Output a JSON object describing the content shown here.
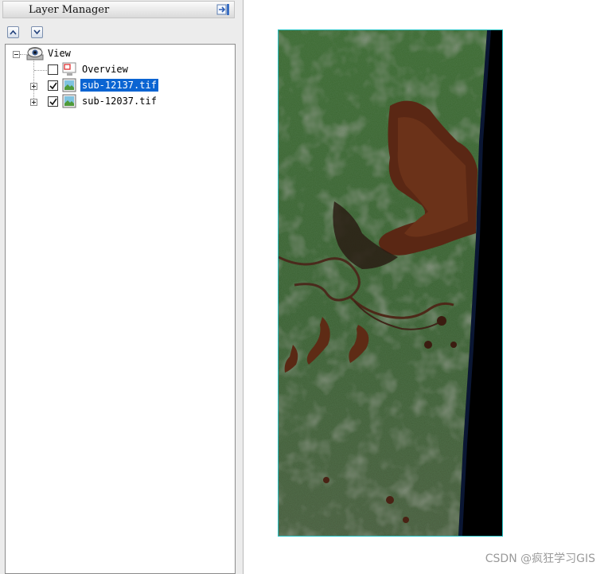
{
  "panel": {
    "title": "Layer Manager"
  },
  "toolbar": {
    "move_up_icon": "chevron-up-icon",
    "move_down_icon": "chevron-down-icon"
  },
  "tree": {
    "root": {
      "label": "View",
      "icon": "eye-icon",
      "expanded": true
    },
    "nodes": [
      {
        "label": "Overview",
        "icon": "overview-monitor-icon",
        "checked": false,
        "selected": false,
        "expandable": false
      },
      {
        "label": "sub-12137.tif",
        "icon": "raster-image-icon",
        "checked": true,
        "selected": true,
        "expandable": true
      },
      {
        "label": "sub-12037.tif",
        "icon": "raster-image-icon",
        "checked": true,
        "selected": false,
        "expandable": true
      }
    ]
  },
  "colors": {
    "selection": "#0a64d2",
    "map_border": "#27c3c6",
    "vegetation": "#3f6a33",
    "water": "#5a2a16",
    "ocean": "#000000"
  },
  "watermark": "CSDN @疯狂学习GIS"
}
